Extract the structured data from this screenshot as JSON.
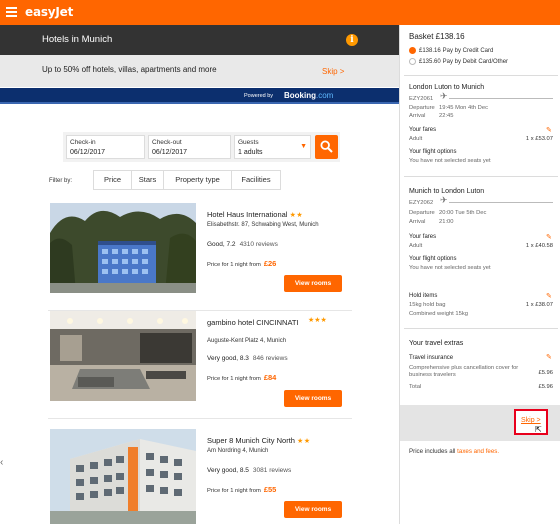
{
  "brand": {
    "logo_text": "easyJet",
    "accent": "#ff6600",
    "dark": "#333333",
    "booking_navy": "#0c2f6e"
  },
  "header": {
    "title": "Hotels in Munich",
    "info_icon": "info-icon"
  },
  "promo": {
    "text": "Up to 50% off hotels, villas, apartments and more",
    "skip_label": "Skip >"
  },
  "booking_bar": {
    "powered_by": "Powered by",
    "brand": "Booking",
    "dotcom": ".com"
  },
  "search": {
    "checkin": {
      "label": "Check-in",
      "value": "06/12/2017"
    },
    "checkout": {
      "label": "Check-out",
      "value": "06/12/2017"
    },
    "guests": {
      "label": "Guests",
      "value": "1 adults"
    },
    "search_icon": "search-icon"
  },
  "filters": {
    "label": "Filter by:",
    "tabs": [
      "Price",
      "Stars",
      "Property type",
      "Facilities"
    ]
  },
  "hotels": [
    {
      "name": "Hotel Haus International",
      "stars": "★★",
      "address": "Elisabethstr. 87, Schwabing West, Munich",
      "rating": "Good, 7.2",
      "reviews": "4310 reviews",
      "price_label": "Price for 1 night from",
      "price": "£26",
      "cta": "View rooms"
    },
    {
      "name": "gambino hotel CINCINNATI",
      "stars": "★★★",
      "address": "Auguste-Kent Platz 4, Munich",
      "rating": "Very good, 8.3",
      "reviews": "846 reviews",
      "price_label": "Price for 1 night from",
      "price": "£84",
      "cta": "View rooms"
    },
    {
      "name": "Super 8 Munich City North",
      "stars": "★★",
      "address": "Am Nordring 4, Munich",
      "rating": "Very good, 8.5",
      "reviews": "3081 reviews",
      "price_label": "Price for 1 night from",
      "price": "£55",
      "cta": "View rooms"
    }
  ],
  "basket": {
    "title": "Basket £138.16",
    "payment": [
      {
        "amount": "£138.16",
        "label": "Pay by Credit Card",
        "selected": true
      },
      {
        "amount": "£135.60",
        "label": "Pay by Debit Card/Other",
        "selected": false
      }
    ],
    "outbound": {
      "route": "London Luton to Munich",
      "flight": "EZY2061",
      "departure_label": "Departure",
      "departure": "19:45 Mon 4th Dec",
      "arrival_label": "Arrival",
      "arrival": "22:45",
      "fares_label": "Your fares",
      "fare_type": "Adult",
      "fare_value": "1 x £53.07",
      "options_label": "Your flight options",
      "options_value": "You have not selected seats yet"
    },
    "inbound": {
      "route": "Munich to London Luton",
      "flight": "EZY2062",
      "departure_label": "Departure",
      "departure": "20:00 Tue 5th Dec",
      "arrival_label": "Arrival",
      "arrival": "21:00",
      "fares_label": "Your fares",
      "fare_type": "Adult",
      "fare_value": "1 x £40.58",
      "options_label": "Your flight options",
      "options_value": "You have not selected seats yet"
    },
    "hold": {
      "label": "Hold items",
      "item": "15kg hold bag",
      "item_value": "1 x £38.07",
      "weight": "Combined weight 15kg"
    },
    "extras": {
      "title": "Your travel extras",
      "insurance_label": "Travel insurance",
      "insurance_desc": "Comprehensive plus cancellation cover for business travelers",
      "insurance_value": "£5.96",
      "total_label": "Total",
      "total_value": "£5.96"
    },
    "skip": "Skip >",
    "includes_prefix": "Price includes all ",
    "includes_link": "taxes and fees."
  }
}
